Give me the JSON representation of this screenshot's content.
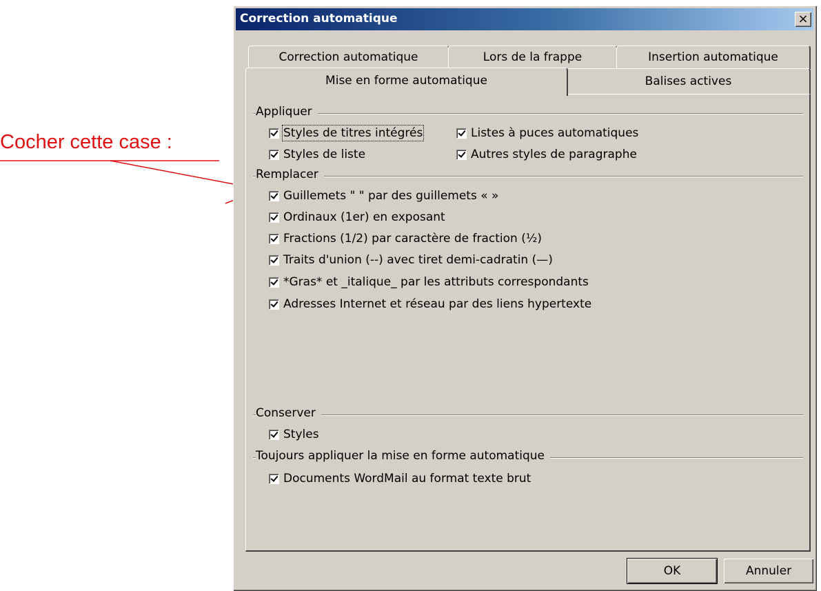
{
  "annotation": {
    "text": "Cocher cette case :",
    "color": "#e01010"
  },
  "dialog": {
    "title": "Correction automatique",
    "close_label": "×",
    "tabs_back": [
      "Correction automatique",
      "Lors de la frappe",
      "Insertion automatique"
    ],
    "tabs_front": [
      "Mise en forme automatique",
      "Balises actives"
    ],
    "active_tab": "Mise en forme automatique",
    "groups": {
      "appliquer": "Appliquer",
      "remplacer": "Remplacer",
      "conserver": "Conserver",
      "toujours": "Toujours appliquer la mise en forme automatique"
    },
    "options": {
      "styles_titres": "Styles de titres intégrés",
      "listes_puces": "Listes à puces automatiques",
      "styles_liste": "Styles de liste",
      "autres_styles": "Autres styles de paragraphe",
      "guillemets": "Guillemets \" \" par des guillemets « »",
      "ordinaux": "Ordinaux (1er) en exposant",
      "fractions": "Fractions (1/2) par caractère de fraction (½)",
      "traits_union": "Traits d'union (--) avec tiret demi-cadratin (—)",
      "gras_italique": "*Gras* et _italique_ par les attributs correspondants",
      "adresses": "Adresses Internet et réseau par des liens hypertexte",
      "styles": "Styles",
      "wordmail": "Documents WordMail au format texte brut"
    },
    "buttons": {
      "ok": "OK",
      "cancel": "Annuler"
    }
  }
}
